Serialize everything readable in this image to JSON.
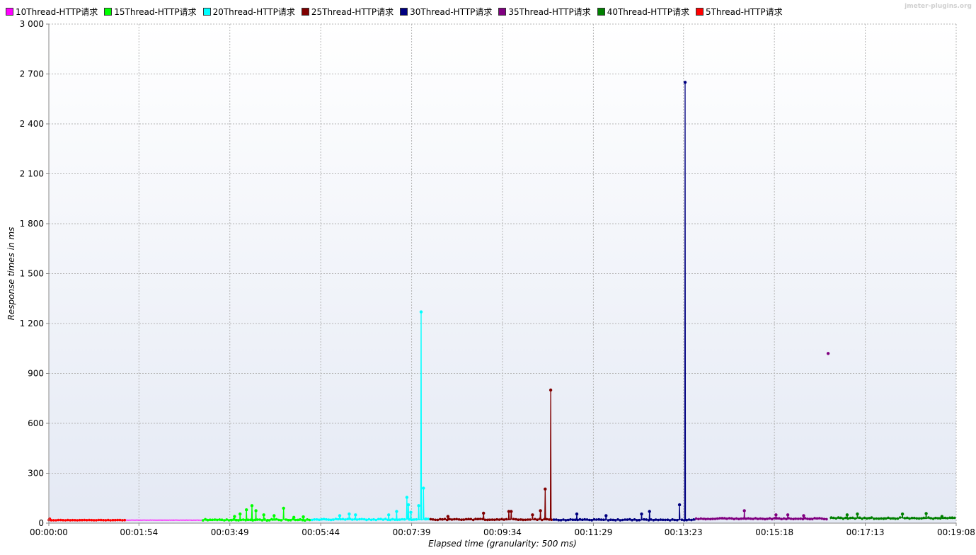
{
  "watermark": "jmeter-plugins.org",
  "chart_data": {
    "type": "line",
    "xlabel": "Elapsed time (granularity: 500 ms)",
    "ylabel": "Response times in ms",
    "ylim": [
      0,
      3000
    ],
    "yticks": [
      0,
      300,
      600,
      900,
      1200,
      1500,
      1800,
      2100,
      2400,
      2700,
      3000
    ],
    "ytick_labels": [
      "0",
      "300",
      "600",
      "900",
      "1 200",
      "1 500",
      "1 800",
      "2 100",
      "2 400",
      "2 700",
      "3 000"
    ],
    "xlim_seconds": [
      0,
      1148
    ],
    "xticks_seconds": [
      0,
      114,
      229,
      344,
      459,
      574,
      689,
      803,
      918,
      1033,
      1148
    ],
    "xtick_labels": [
      "00:00:00",
      "00:01:54",
      "00:03:49",
      "00:05:44",
      "00:07:39",
      "00:09:34",
      "00:11:29",
      "00:13:23",
      "00:15:18",
      "00:17:13",
      "00:19:08"
    ],
    "grid": true,
    "legend_position": "top",
    "series": [
      {
        "name": "10Thread-HTTP请求",
        "color": "#ff00ff",
        "t_start": 97,
        "t_end": 194,
        "baseline": 18,
        "noise": 2,
        "markers": false,
        "spikes": []
      },
      {
        "name": "15Thread-HTTP请求",
        "color": "#00ff00",
        "t_start": 194,
        "t_end": 331,
        "baseline": 20,
        "noise": 9,
        "markers": true,
        "spikes": [
          [
            235,
            40
          ],
          [
            242,
            55
          ],
          [
            250,
            80
          ],
          [
            257,
            105
          ],
          [
            262,
            75
          ],
          [
            272,
            50
          ],
          [
            285,
            45
          ],
          [
            297,
            90
          ],
          [
            310,
            35
          ],
          [
            322,
            38
          ]
        ]
      },
      {
        "name": "20Thread-HTTP请求",
        "color": "#00ffff",
        "t_start": 331,
        "t_end": 482,
        "baseline": 22,
        "noise": 7,
        "markers": true,
        "spikes": [
          [
            368,
            45
          ],
          [
            380,
            55
          ],
          [
            388,
            50
          ],
          [
            430,
            50
          ],
          [
            440,
            70
          ],
          [
            453,
            155
          ],
          [
            455,
            110
          ],
          [
            458,
            65
          ],
          [
            468,
            105
          ],
          [
            471,
            1270
          ],
          [
            474,
            210
          ],
          [
            477,
            25
          ]
        ]
      },
      {
        "name": "25Thread-HTTP请求",
        "color": "#800000",
        "t_start": 482,
        "t_end": 636,
        "baseline": 22,
        "noise": 6,
        "markers": true,
        "spikes": [
          [
            505,
            40
          ],
          [
            550,
            60
          ],
          [
            582,
            70
          ],
          [
            585,
            70
          ],
          [
            612,
            50
          ],
          [
            622,
            75
          ],
          [
            628,
            205
          ],
          [
            635,
            800
          ]
        ]
      },
      {
        "name": "30Thread-HTTP请求",
        "color": "#000080",
        "t_start": 638,
        "t_end": 818,
        "baseline": 20,
        "noise": 6,
        "markers": true,
        "spikes": [
          [
            668,
            55
          ],
          [
            705,
            45
          ],
          [
            750,
            55
          ],
          [
            760,
            70
          ],
          [
            798,
            110
          ],
          [
            805,
            2650
          ]
        ]
      },
      {
        "name": "35Thread-HTTP请求",
        "color": "#800080",
        "t_start": 818,
        "t_end": 984,
        "baseline": 27,
        "noise": 7,
        "markers": true,
        "spikes": [
          [
            880,
            75
          ],
          [
            920,
            50
          ],
          [
            935,
            50
          ],
          [
            955,
            45
          ],
          [
            986,
            1020
          ]
        ]
      },
      {
        "name": "40Thread-HTTP请求",
        "color": "#008000",
        "t_start": 988,
        "t_end": 1146,
        "baseline": 30,
        "noise": 8,
        "markers": true,
        "spikes": [
          [
            1010,
            50
          ],
          [
            1023,
            55
          ],
          [
            1080,
            55
          ],
          [
            1110,
            58
          ],
          [
            1130,
            40
          ]
        ]
      },
      {
        "name": "5Thread-HTTP请求",
        "color": "#ff0000",
        "t_start": 0,
        "t_end": 97,
        "baseline": 18,
        "noise": 2,
        "markers": true,
        "spikes": [
          [
            1,
            25
          ]
        ]
      }
    ]
  }
}
